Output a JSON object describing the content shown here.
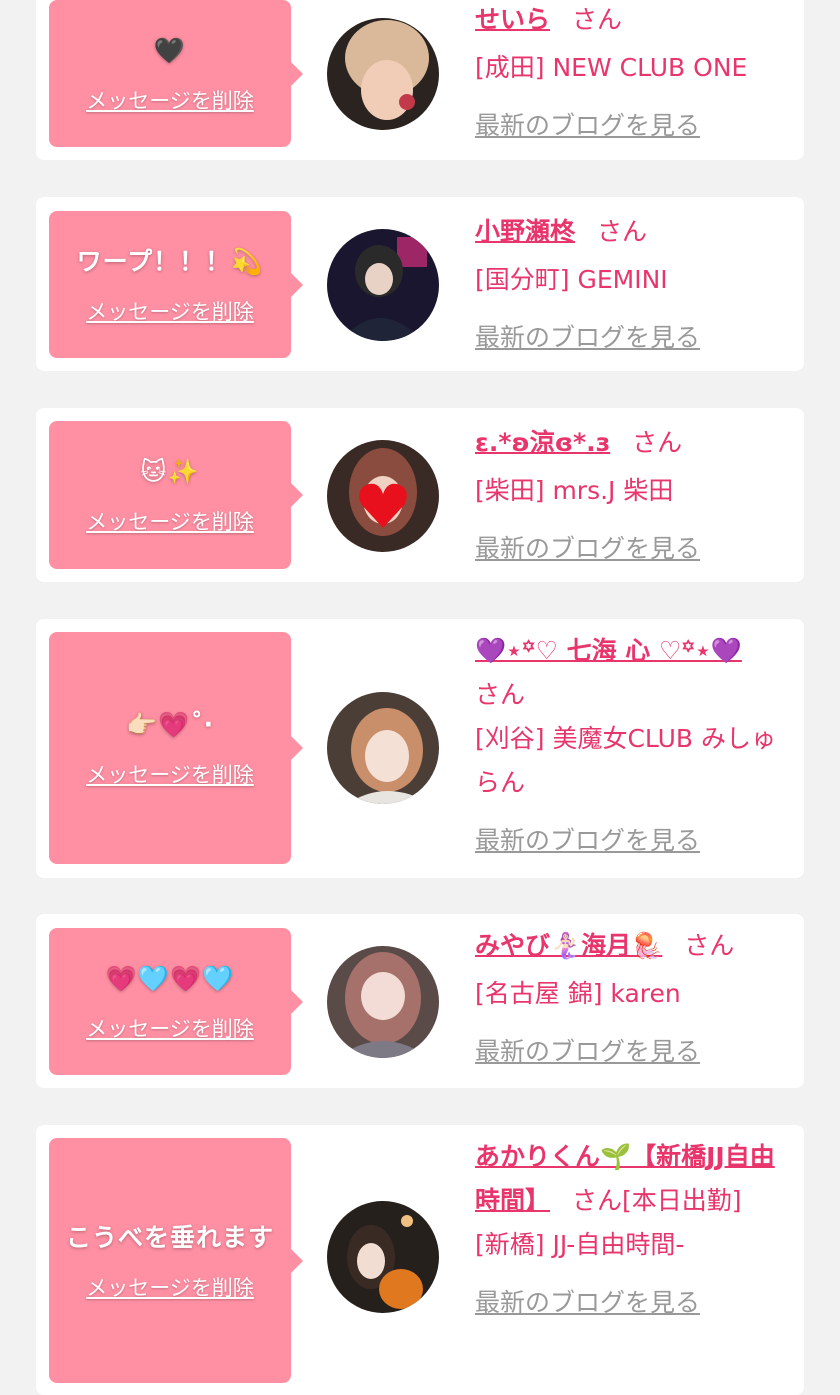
{
  "colors": {
    "page_bg": "#f2f2f2",
    "card_bg": "#ffffff",
    "bubble_bg": "#ff8fa3",
    "accent_pink": "#e8366c",
    "link_gray": "#999999"
  },
  "labels": {
    "delete": "メッセージを削除",
    "blog": "最新のブログを見る",
    "honorific": "さん"
  },
  "entries": [
    {
      "message": "🖤",
      "name": "せいら",
      "shop": "[成田] NEW CLUB ONE",
      "avatar_icon": "profile-photo"
    },
    {
      "message": "ワープ！！！💫",
      "name": "小野瀬柊",
      "shop": "[国分町] GEMINI",
      "avatar_icon": "profile-photo"
    },
    {
      "message": "🐱✨",
      "name": "ε.*ʚ涼ɞ*.з",
      "shop": "[柴田] mrs.J 柴田",
      "avatar_icon": "profile-photo"
    },
    {
      "message": "👉🏻💗˚‧",
      "name": "💜⋆꙳♡ 七海 心 ♡꙳⋆💜",
      "shop": "[刈谷] 美魔女CLUB みしゅらん",
      "avatar_icon": "profile-photo"
    },
    {
      "message": "💗🩵💗🩵",
      "name": "みやび🧜🏻‍♀️海月🪼",
      "shop": "[名古屋 錦] karen",
      "avatar_icon": "profile-photo"
    },
    {
      "message": "こうべを垂れます",
      "name": "あかりくん🌱【新橋JJ自由時間】",
      "honorific_suffix": "[本日出勤]",
      "shop": "[新橋] JJ-自由時間-",
      "avatar_icon": "profile-photo"
    }
  ]
}
